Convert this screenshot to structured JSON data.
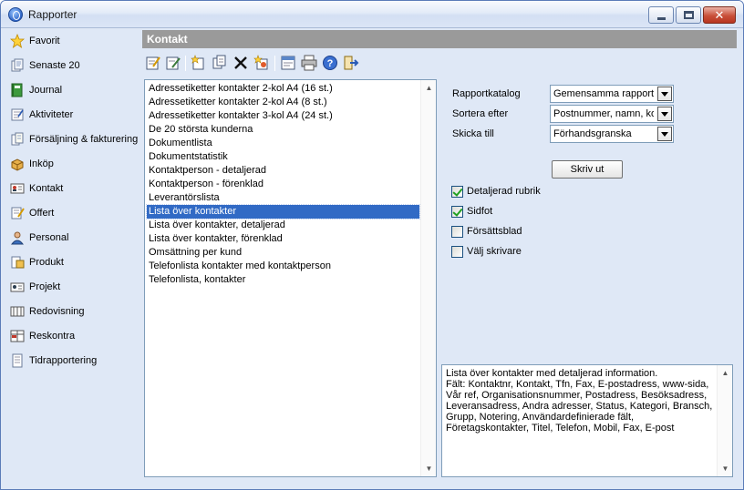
{
  "window": {
    "title": "Rapporter"
  },
  "sidebar": {
    "items": [
      {
        "label": "Favorit",
        "icon": "star-icon"
      },
      {
        "label": "Senaste 20",
        "icon": "recent-documents-icon"
      },
      {
        "label": "Journal",
        "icon": "journal-icon"
      },
      {
        "label": "Aktiviteter",
        "icon": "activities-icon"
      },
      {
        "label": "Försäljning & fakturering",
        "icon": "sales-invoice-icon"
      },
      {
        "label": "Inköp",
        "icon": "purchase-icon"
      },
      {
        "label": "Kontakt",
        "icon": "contact-card-icon"
      },
      {
        "label": "Offert",
        "icon": "quote-icon"
      },
      {
        "label": "Personal",
        "icon": "staff-icon"
      },
      {
        "label": "Produkt",
        "icon": "product-icon"
      },
      {
        "label": "Projekt",
        "icon": "project-icon"
      },
      {
        "label": "Redovisning",
        "icon": "accounting-icon"
      },
      {
        "label": "Reskontra",
        "icon": "ledger-icon"
      },
      {
        "label": "Tidrapportering",
        "icon": "time-report-icon"
      }
    ]
  },
  "panel": {
    "title": "Kontakt"
  },
  "toolbar": {
    "buttons": [
      "edit-report-icon",
      "edit-design-icon",
      "new-report-icon",
      "copy-report-icon",
      "delete-icon",
      "settings-wizard-icon",
      "properties-icon",
      "print-icon",
      "help-icon",
      "exit-icon"
    ]
  },
  "reports": {
    "items": [
      "Adressetiketter kontakter 2-kol A4 (16 st.)",
      "Adressetiketter kontakter 2-kol A4 (8 st.)",
      "Adressetiketter kontakter 3-kol A4 (24 st.)",
      "De 20 största kunderna",
      "Dokumentlista",
      "Dokumentstatistik",
      "Kontaktperson - detaljerad",
      "Kontaktperson - förenklad",
      "Leverantörslista",
      "Lista över kontakter",
      "Lista över kontakter, detaljerad",
      "Lista över kontakter, förenklad",
      "Omsättning per kund",
      "Telefonlista kontakter med kontaktperson",
      "Telefonlista, kontakter"
    ],
    "selected_index": 9
  },
  "form": {
    "catalog_label": "Rapportkatalog",
    "catalog_value": "Gemensamma rapporter",
    "sort_label": "Sortera efter",
    "sort_value": "Postnummer, namn, kon",
    "send_label": "Skicka till",
    "send_value": "Förhandsgranska",
    "print_button": "Skriv ut",
    "checkboxes": [
      {
        "label": "Detaljerad rubrik",
        "checked": true
      },
      {
        "label": "Sidfot",
        "checked": true
      },
      {
        "label": "Försättsblad",
        "checked": false
      },
      {
        "label": "Välj skrivare",
        "checked": false
      }
    ]
  },
  "description": {
    "line1": "Lista över kontakter med detaljerad information.",
    "line2": "Fält: Kontaktnr, Kontakt, Tfn, Fax, E-postadress, www-sida, Vår ref, Organisationsnummer, Postadress, Besöksadress, Leveransadress, Andra adresser, Status, Kategori, Bransch, Grupp, Notering, Användardefinierade fält, Företagskontakter, Titel, Telefon, Mobil, Fax, E-post"
  }
}
